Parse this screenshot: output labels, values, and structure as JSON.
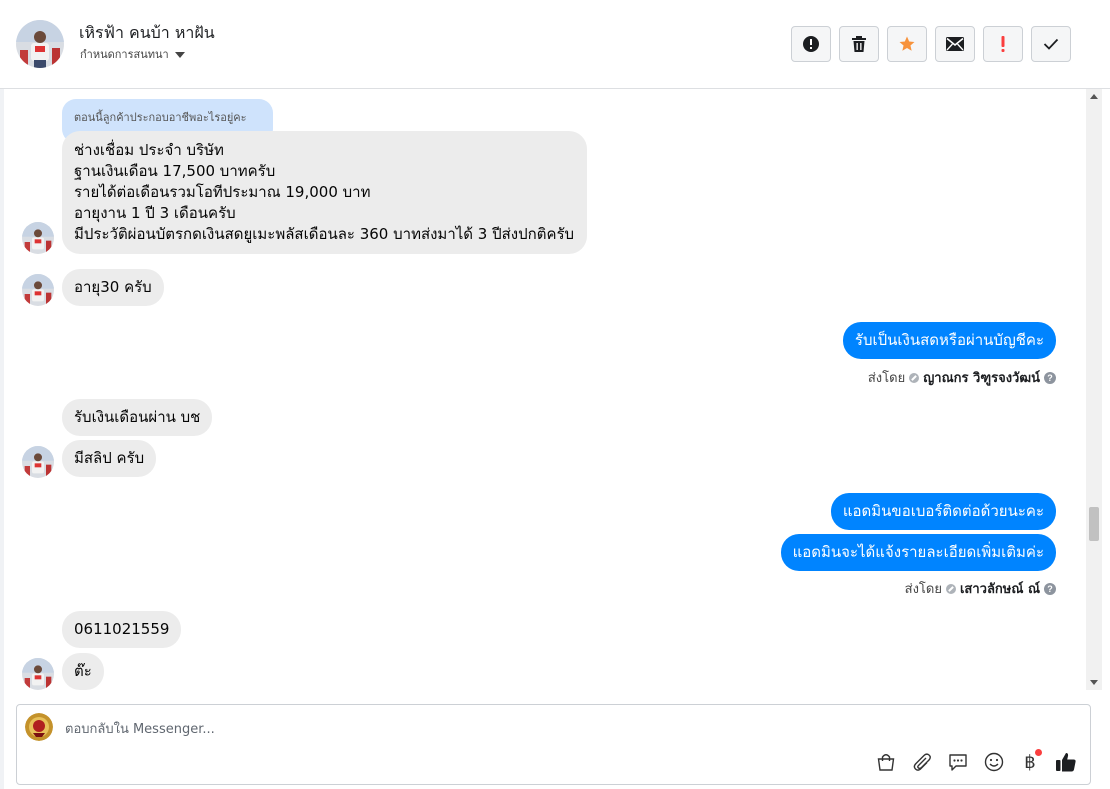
{
  "header": {
    "contact_name": "เหิรฟ้า คนบ้า หาฝัน",
    "assign_label": "กำหนดการสนทนา"
  },
  "toolbar": {
    "buttons": [
      {
        "name": "mark-spam-button",
        "icon": "alert-circle-icon"
      },
      {
        "name": "delete-button",
        "icon": "trash-icon"
      },
      {
        "name": "star-button",
        "icon": "star-icon"
      },
      {
        "name": "mark-unread-button",
        "icon": "envelope-icon"
      },
      {
        "name": "follow-up-button",
        "icon": "exclamation-icon"
      },
      {
        "name": "mark-done-button",
        "icon": "checkmark-icon"
      }
    ],
    "colors": {
      "star": "#f7923b",
      "exclamation": "#fa3e3e"
    }
  },
  "messages": {
    "reply_quote": "ตอนนี้ลูกค้าประกอบอาชีพอะไรอยู่คะ",
    "m1": [
      "ช่างเชื่อม ประจำ บริษัท",
      "ฐานเงินเดือน 17,500 บาทครับ",
      "รายได้ต่อเดือนรวมโอทีประมาณ 19,000 บาท",
      "อายุงาน 1 ปี 3 เดือนครับ",
      "มีประวัติผ่อนบัตรกดเงินสดยูเมะพลัสเดือนละ 360 บาทส่งมาได้ 3 ปีส่งปกติครับ"
    ],
    "m2": "อายุ30 ครับ",
    "m3": "รับเป็นเงินสดหรือผ่านบัญชีคะ",
    "sent1": {
      "prefix": "ส่งโดย",
      "agent": "ญาณกร วิฑูรจงวัฒน์"
    },
    "m4": "รับเงินเดือนผ่าน บช",
    "m5": "มีสลิป ครับ",
    "m6": "แอดมินขอเบอร์ติดต่อด้วยนะคะ",
    "m7": "แอดมินจะได้แจ้งรายละเอียดเพิ่มเติมค่ะ",
    "sent2": {
      "prefix": "ส่งโดย",
      "agent": "เสาวลักษณ์ ณ์"
    },
    "m8": "0611021559",
    "m9": "ต๊ะ"
  },
  "composer": {
    "placeholder": "ตอบกลับใน Messenger...",
    "tools": [
      "shopping-bag-icon",
      "paperclip-icon",
      "saved-reply-icon",
      "emoji-icon",
      "baht-payment-icon",
      "thumbs-up-icon"
    ],
    "baht_symbol": "฿"
  },
  "colors": {
    "outgoing_bubble": "#0084ff",
    "incoming_bubble": "#ececec",
    "reply_quote": "#cfe3fc"
  }
}
